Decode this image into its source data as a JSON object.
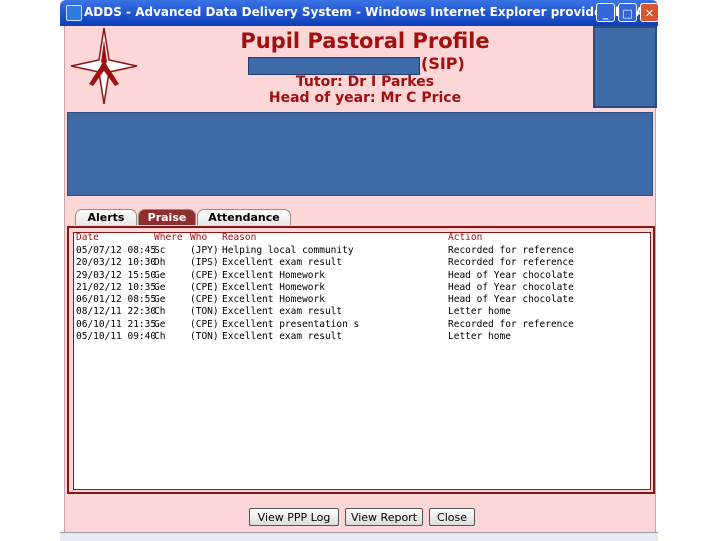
{
  "window": {
    "title": "ADDS - Advanced Data Delivery System - Windows Internet Explorer provided by Arnewood IC...",
    "minimize": "_",
    "maximize": "□",
    "close": "✕"
  },
  "header": {
    "title": "Pupil Pastoral Profile",
    "sip": "(SIP)",
    "tutor": "Tutor: Dr I Parkes",
    "head_of_year": "Head of year: Mr C Price"
  },
  "tabs": [
    {
      "label": "Alerts"
    },
    {
      "label": "Praise"
    },
    {
      "label": "Attendance"
    }
  ],
  "list": {
    "columns": [
      "Date",
      "Where",
      "Who",
      "Reason",
      "Action"
    ],
    "rows": [
      {
        "date": "05/07/12 08:45",
        "where": "Sc",
        "who": "(JPY)",
        "reason": "Helping local community",
        "action": "Recorded for reference"
      },
      {
        "date": "20/03/12 10:30",
        "where": "Dh",
        "who": "(IPS)",
        "reason": "Excellent exam result",
        "action": "Recorded for reference"
      },
      {
        "date": "29/03/12 15:50",
        "where": "Ge",
        "who": "(CPE)",
        "reason": "Excellent Homework",
        "action": "Head of Year chocolate"
      },
      {
        "date": "21/02/12 10:35",
        "where": "Ge",
        "who": "(CPE)",
        "reason": "Excellent Homework",
        "action": "Head of Year chocolate"
      },
      {
        "date": "06/01/12 08:55",
        "where": "Ge",
        "who": "(CPE)",
        "reason": "Excellent Homework",
        "action": "Head of Year chocolate"
      },
      {
        "date": "08/12/11 22:30",
        "where": "Ch",
        "who": "(TON)",
        "reason": "Excellent exam result",
        "action": "Letter home"
      },
      {
        "date": "06/10/11 21:35",
        "where": "Ge",
        "who": "(CPE)",
        "reason": "Excellent presentation s",
        "action": "Recorded for reference"
      },
      {
        "date": "05/10/11 09:40",
        "where": "Ch",
        "who": "(TON)",
        "reason": "Excellent exam result",
        "action": "Letter home"
      }
    ]
  },
  "buttons": {
    "view_ppp_log": "View PPP Log",
    "view_report": "View Report",
    "close": "Close"
  },
  "colors": {
    "background": "#fdd7d7",
    "accent": "#a01010",
    "redaction": "#3f6aa8",
    "titlebar": "#2358d6"
  }
}
